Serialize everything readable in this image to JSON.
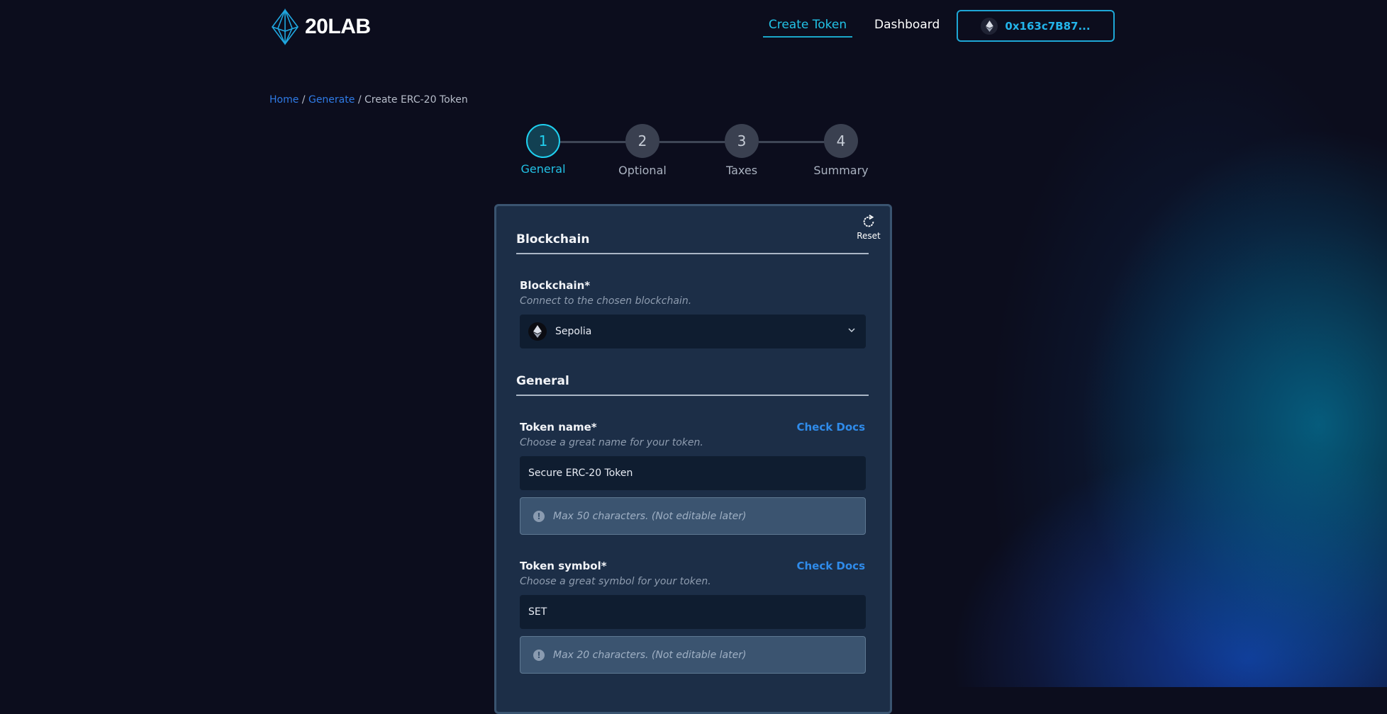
{
  "header": {
    "logo_text": "20LAB",
    "nav": {
      "create_token": "Create Token",
      "dashboard": "Dashboard"
    },
    "wallet": {
      "address": "0x163c7B87...",
      "icon": "ethereum-icon"
    }
  },
  "breadcrumb": {
    "home": "Home",
    "separator": "/",
    "generate": "Generate",
    "current": "Create ERC-20 Token"
  },
  "stepper": {
    "active_step": 1,
    "steps": [
      {
        "number": "1",
        "label": "General"
      },
      {
        "number": "2",
        "label": "Optional"
      },
      {
        "number": "3",
        "label": "Taxes"
      },
      {
        "number": "4",
        "label": "Summary"
      }
    ]
  },
  "card": {
    "reset_label": "Reset",
    "blockchain_section": {
      "title": "Blockchain",
      "field_label": "Blockchain*",
      "field_help": "Connect to the chosen blockchain.",
      "selected": "Sepolia"
    },
    "general_section": {
      "title": "General",
      "token_name": {
        "label": "Token name*",
        "help": "Choose a great name for your token.",
        "docs_link": "Check Docs",
        "value": "Secure ERC-20 Token",
        "hint": "Max 50 characters. (Not editable later)"
      },
      "token_symbol": {
        "label": "Token symbol*",
        "help": "Choose a great symbol for your token.",
        "docs_link": "Check Docs",
        "value": "SET",
        "hint": "Max 20 characters. (Not editable later)"
      }
    }
  },
  "colors": {
    "accent": "#22c2e6",
    "link": "#2f7be6",
    "background": "#0c0d1d",
    "card": "#1c2e47"
  }
}
